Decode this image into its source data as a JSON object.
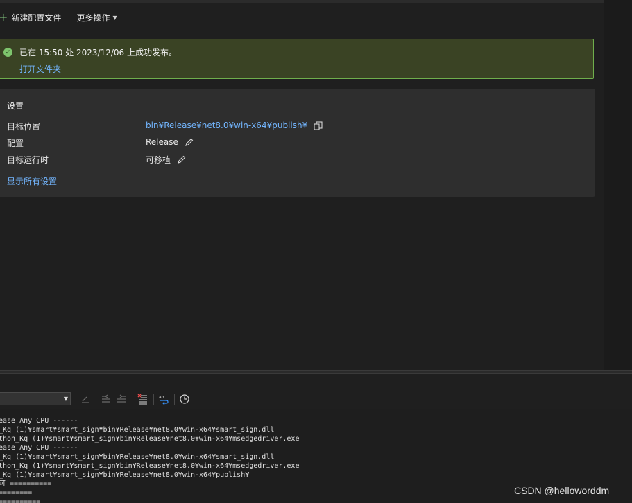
{
  "toolbar": {
    "new_profile_label": "新建配置文件",
    "more_actions_label": "更多操作"
  },
  "banner": {
    "message": "已在 15:50 处 2023/12/06 上成功发布。",
    "open_folder_link": "打开文件夹"
  },
  "settings": {
    "title": "设置",
    "rows": [
      {
        "label": "目标位置",
        "value": "bin¥Release¥net8.0¥win-x64¥publish¥"
      },
      {
        "label": "配置",
        "value": "Release"
      },
      {
        "label": "目标运行时",
        "value": "可移植"
      }
    ],
    "show_all_link": "显示所有设置"
  },
  "output": {
    "lines": [
      "ease Any CPU ------",
      "_Kq (1)¥smart¥smart_sign¥bin¥Release¥net8.0¥win-x64¥smart_sign.dll",
      "thon_Kq (1)¥smart¥smart_sign¥bin¥Release¥net8.0¥win-x64¥msedgedriver.exe",
      "ease Any CPU ------",
      "_Kq (1)¥smart¥smart_sign¥bin¥Release¥net8.0¥win-x64¥smart_sign.dll",
      "thon_Kq (1)¥smart¥smart_sign¥bin¥Release¥net8.0¥win-x64¥msedgedriver.exe",
      "_Kq (1)¥smart¥smart_sign¥bin¥Release¥net8.0¥win-x64¥publish¥",
      "可 ==========",
      "========",
      "=========="
    ]
  },
  "watermark": "CSDN @helloworddm",
  "colors": {
    "background": "#1f1f1f",
    "success_border": "#6fae4c",
    "success_fill": "#3a4324",
    "link": "#73b6ff",
    "panel": "#2e2e2e"
  }
}
